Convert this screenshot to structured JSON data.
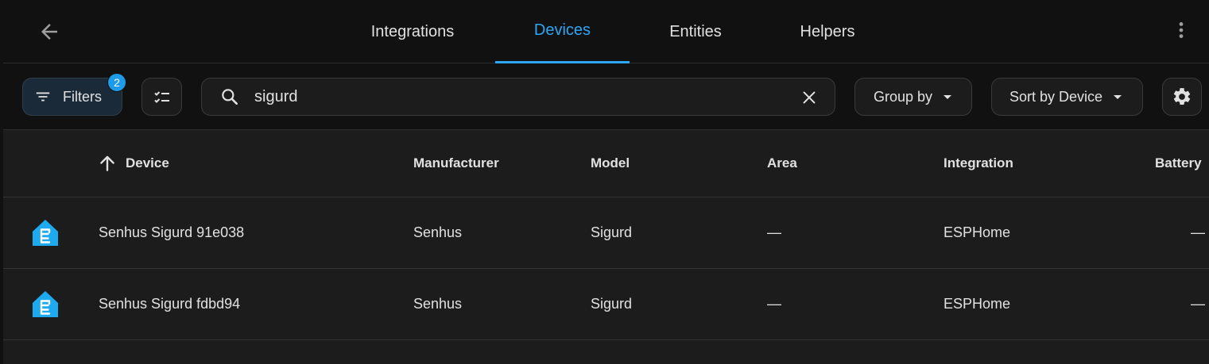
{
  "tabs": [
    {
      "label": "Integrations",
      "active": false
    },
    {
      "label": "Devices",
      "active": true
    },
    {
      "label": "Entities",
      "active": false
    },
    {
      "label": "Helpers",
      "active": false
    }
  ],
  "toolbar": {
    "filters_label": "Filters",
    "filters_count": "2",
    "search_value": "sigurd",
    "group_by_label": "Group by",
    "sort_by_label": "Sort by Device"
  },
  "table": {
    "columns": [
      "Device",
      "Manufacturer",
      "Model",
      "Area",
      "Integration",
      "Battery"
    ],
    "sort_column": "Device",
    "sort_direction": "ascending",
    "rows": [
      {
        "device": "Senhus Sigurd 91e038",
        "manufacturer": "Senhus",
        "model": "Sigurd",
        "area": "—",
        "integration": "ESPHome",
        "battery": "—"
      },
      {
        "device": "Senhus Sigurd fdbd94",
        "manufacturer": "Senhus",
        "model": "Sigurd",
        "area": "—",
        "integration": "ESPHome",
        "battery": "—"
      }
    ]
  },
  "colors": {
    "accent": "#2fa6f3",
    "badge": "#1e9be8",
    "background": "#1c1c1c",
    "bar": "#111111",
    "device_icon": "#1eaaf1"
  },
  "icons": {
    "back": "arrow-left-icon",
    "menu": "dots-vertical-icon",
    "filter": "filter-lines-icon",
    "select_mode": "checklist-icon",
    "search": "magnify-icon",
    "clear": "close-icon",
    "settings": "cog-icon",
    "sort": "arrow-up-icon",
    "device": "esphome-icon"
  }
}
